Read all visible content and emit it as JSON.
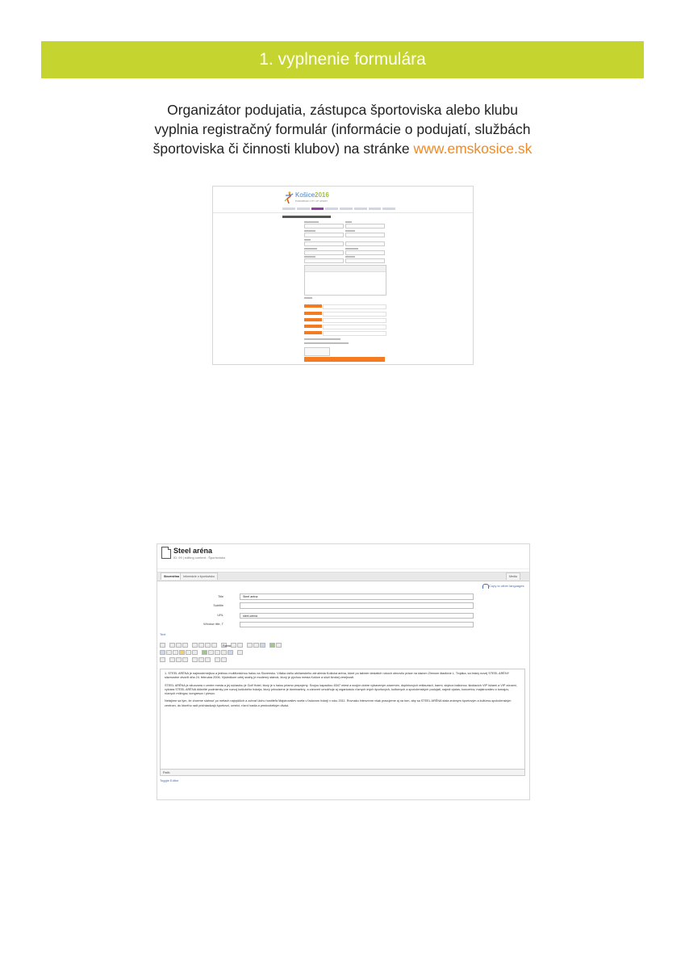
{
  "banner": {
    "title": "1. vyplnenie formulára"
  },
  "intro": {
    "line1": "Organizátor podujatia, zástupca športoviska alebo klubu",
    "line2": "vyplnia registračný formulár (informácie o podujatí, službách",
    "line3_prefix": "športoviska či činnosti klubov) na stránke ",
    "link": "www.emskosice.sk"
  },
  "screenshot1": {
    "logo_text": "Košice",
    "logo_year": "2016",
    "logo_sub": "EUROPEAN CITY OF SPORT"
  },
  "screenshot2": {
    "title": "Steel aréna",
    "subtitle": "ID: 99 | editing content : Športovisko",
    "tabs": {
      "active": "Slovenčina",
      "other": "Informácie o športovisku",
      "right": "Media"
    },
    "copy_link": "Copy to other languages",
    "fields": {
      "title_label": "Title",
      "title_value": "Steel aréna",
      "subtitle_label": "Subtitle",
      "subtitle_value": "",
      "url_label": "URL",
      "url_value": "steel-arena",
      "order_label": "Window title, T",
      "order_value": ""
    },
    "text_link": "Text",
    "format_select": "Formát",
    "content": {
      "p1": "1. STEEL ARÉNA je najmodernejšou a jedinou multifunkčnou halou na Slovensku. Vďaka úsiliu občianskeho združenia Košická aréna, ktoré po takmer desiatich rokoch obnovilo práce na starom Zimnom štadióne L. Trojáka, sa brány novej STEEL ARÉNY slávnostne otvorili dňa 24. februára 2006. Výsledkom celej snahy je moderný stánok, ktorý je pýchou mesta Košice a slúži širokej verejnosti.",
      "p2": "STEEL ARÉNA je situovaná v centre mesta a jej súčasťou je Golf Hotel, ktorý je s halou priamo prepojený. Svojou kapacitou 8347 miest a svojím dobre vybaveným zázemím, doplnkových reštaurácií, barmi, skybox balkónov, školiacich VIP lóžami a VIP zónami, vytvára STEEL ARÉNA dôležité podmienky pre rozvoj košického hokeja, ktorý prirodzene je dominantný, a zároveň umožňuje aj organizáciu rôznych iných športových, kultúrnych a spoločenských podujatí, najmä výstav, koncertov, majstrovstiev a turnajov, rôznych mítingov, kongresov i plesov.",
      "p3": "Netajíme sa tým, že chceme siahnuť po métach najvyšších a zohrať úlohu hostiteľa Majstrovstiev sveta v ľadovom hokeji v roku 2011. Rovnako intenzívne však pracujeme aj na tom, aby sa STEEL ARÉNA stala známym športovým a kultúrno-spoločenským centrom, do ktorého radi pricháadzajú športovci, umelci, rôzni hostia a predovšetkým diváci."
    },
    "path_label": "Path:",
    "toggle_link": "Toggle Editor"
  }
}
